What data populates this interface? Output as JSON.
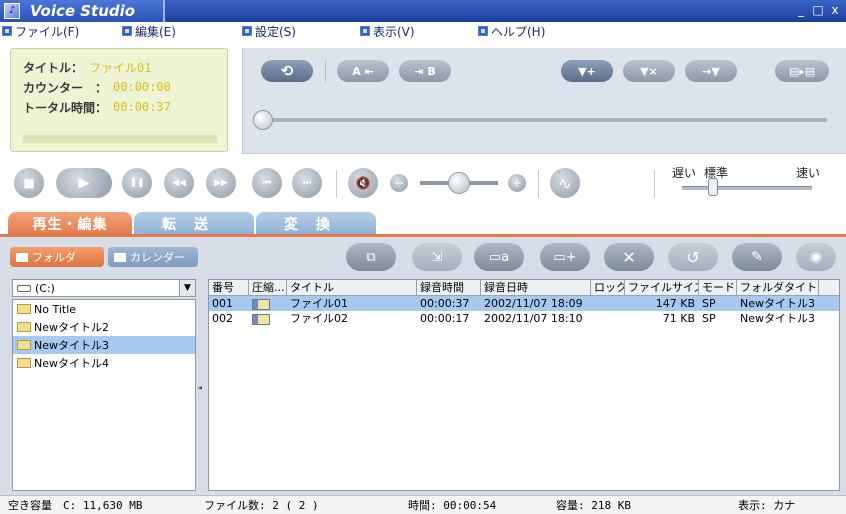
{
  "window": {
    "title": "Voice Studio",
    "controls": [
      "_",
      "□",
      "x"
    ]
  },
  "menu": [
    {
      "label": "ファイル(F)"
    },
    {
      "label": "編集(E)"
    },
    {
      "label": "設定(S)"
    },
    {
      "label": "表示(V)"
    },
    {
      "label": "ヘルプ(H)"
    }
  ],
  "info": {
    "title_label": "タイトル：",
    "title_value": "ファイル01",
    "counter_label": "カウンター　：",
    "counter_value": "00:00:00",
    "total_label": "トータル時間：",
    "total_value": "00:00:37"
  },
  "edit_buttons": {
    "repeat": "⟲",
    "a_label": "A ⇤",
    "b_label": "⇥ B",
    "mark_add": "▼+",
    "mark_del": "▼×",
    "mark_jump": "→▼",
    "split": "▤▸▤"
  },
  "transport": {
    "stop": "■",
    "play": "▶",
    "pause": "❚❚",
    "rewind": "◀◀",
    "forward": "▶▶",
    "prev": "⏮",
    "next": "⏭",
    "mute": "🔇",
    "vol_minus": "−",
    "vol_plus": "+",
    "wave": "∿",
    "speed_slow": "遅い",
    "speed_normal": "標準",
    "speed_fast": "速い"
  },
  "tabs": {
    "edit": "再生・編集",
    "transfer": "転送",
    "convert": "変換"
  },
  "views": {
    "folder": "フォルダ",
    "calendar": "カレンダー"
  },
  "actions": [
    "⧉",
    "⇲",
    "▭a",
    "▭+",
    "✕",
    "↺",
    "✎",
    "◉"
  ],
  "drive": {
    "label": "(C:)"
  },
  "folders": [
    {
      "name": "No Title",
      "selected": false
    },
    {
      "name": "Newタイトル2",
      "selected": false
    },
    {
      "name": "Newタイトル3",
      "selected": true
    },
    {
      "name": "Newタイトル4",
      "selected": false
    }
  ],
  "table": {
    "columns": [
      "番号",
      "圧縮...",
      "タイトル",
      "録音時間",
      "録音日時",
      "ロック",
      "ファイルサイズ",
      "モード",
      "フォルダタイトル"
    ],
    "rows": [
      {
        "no": "001",
        "title": "ファイル01",
        "duration": "00:00:37",
        "datetime": "2002/11/07 18:09",
        "lock": "",
        "size": "147 KB",
        "mode": "SP",
        "folder": "Newタイトル3",
        "selected": true
      },
      {
        "no": "002",
        "title": "ファイル02",
        "duration": "00:00:17",
        "datetime": "2002/11/07 18:10",
        "lock": "",
        "size": "71 KB",
        "mode": "SP",
        "folder": "Newタイトル3",
        "selected": false
      }
    ]
  },
  "status": {
    "free": "空き容量　C: 11,630 MB",
    "files": "ファイル数: 2 ( 2 )",
    "time": "時間: 00:00:54",
    "capacity": "容量: 218 KB",
    "display": "表示: カナ"
  }
}
